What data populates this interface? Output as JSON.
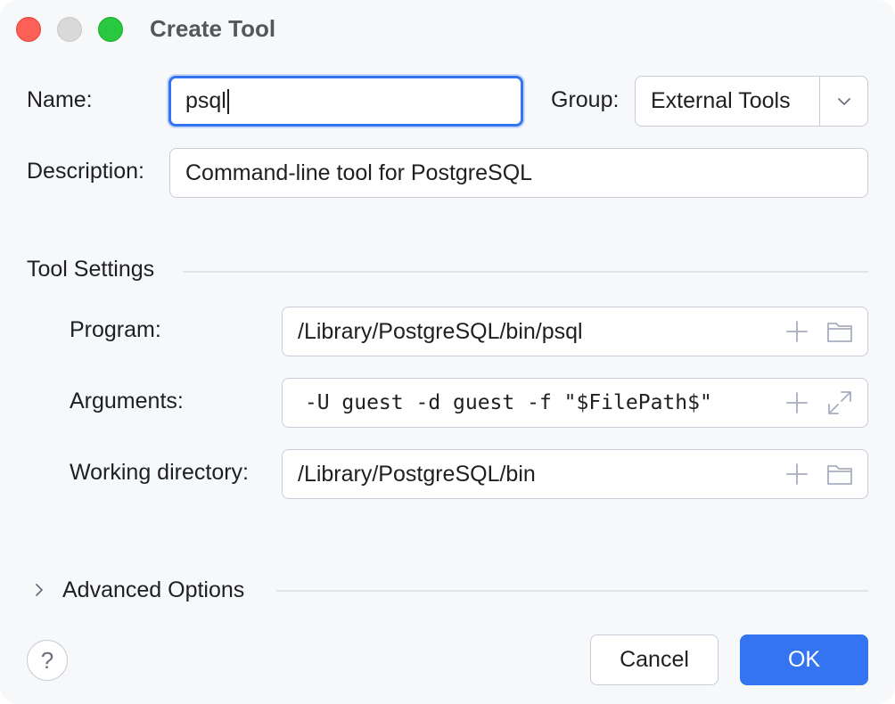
{
  "window": {
    "title": "Create Tool"
  },
  "form": {
    "name_label": "Name:",
    "name_value": "psql",
    "group_label": "Group:",
    "group_value": "External Tools",
    "description_label": "Description:",
    "description_value": "Command-line tool for PostgreSQL"
  },
  "tool_settings": {
    "section_title": "Tool Settings",
    "program_label": "Program:",
    "program_value": "/Library/PostgreSQL/bin/psql",
    "arguments_label": "Arguments:",
    "arguments_value": " -U guest -d guest -f \"$FilePath$\"",
    "working_dir_label": "Working directory:",
    "working_dir_value": "/Library/PostgreSQL/bin"
  },
  "advanced": {
    "label": "Advanced Options",
    "expanded": false
  },
  "footer": {
    "help_label": "?",
    "cancel_label": "Cancel",
    "ok_label": "OK"
  },
  "colors": {
    "accent": "#3574f0",
    "close": "#fe5f57",
    "zoom": "#28c840",
    "minimize": "#d9d9d9"
  },
  "icons": [
    "add-macro-icon",
    "browse-folder-icon",
    "expand-icon",
    "chevron-down-icon",
    "chevron-right-icon",
    "help-icon"
  ]
}
